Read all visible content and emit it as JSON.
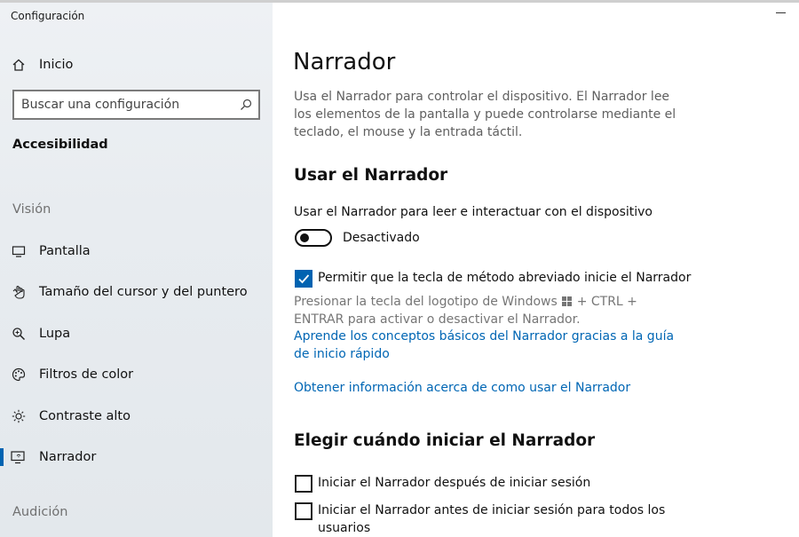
{
  "app": {
    "title": "Configuración"
  },
  "sidebar": {
    "home_label": "Inicio",
    "search_placeholder": "Buscar una configuración",
    "section_title": "Accesibilidad",
    "group_vision": "Visión",
    "items": [
      {
        "label": "Pantalla",
        "icon": "monitor-icon"
      },
      {
        "label": "Tamaño del cursor y del puntero",
        "icon": "cursor-icon"
      },
      {
        "label": "Lupa",
        "icon": "magnifier-icon"
      },
      {
        "label": "Filtros de color",
        "icon": "palette-icon"
      },
      {
        "label": "Contraste alto",
        "icon": "sun-icon"
      },
      {
        "label": "Narrador",
        "icon": "narrator-icon",
        "active": true
      }
    ],
    "group_audio": "Audición"
  },
  "main": {
    "title": "Narrador",
    "description": "Usa el Narrador para controlar el dispositivo. El Narrador lee los elementos de la pantalla y puede controlarse mediante el teclado, el mouse y la entrada táctil.",
    "section1": {
      "heading": "Usar el Narrador",
      "toggle_label": "Usar el Narrador para leer e interactuar con el dispositivo",
      "toggle_state": "Desactivado",
      "toggle_on": false,
      "shortcut_checkbox_label": "Permitir que la tecla de método abreviado inicie el Narrador",
      "shortcut_checked": true,
      "hint_part1": "Presionar la tecla del logotipo de Windows",
      "hint_part2": "+ CTRL + ENTRAR para activar o desactivar el Narrador.",
      "link_quickstart": "Aprende los conceptos básicos del Narrador gracias a la guía de inicio rápido",
      "link_info": "Obtener información acerca de como usar el Narrador"
    },
    "section2": {
      "heading": "Elegir cuándo iniciar el Narrador",
      "option1": "Iniciar el Narrador después de iniciar sesión",
      "option1_checked": false,
      "option2": "Iniciar el Narrador antes de iniciar sesión para todos los usuarios",
      "option2_checked": false
    }
  },
  "colors": {
    "accent": "#0063b1",
    "link": "#0066b4"
  }
}
